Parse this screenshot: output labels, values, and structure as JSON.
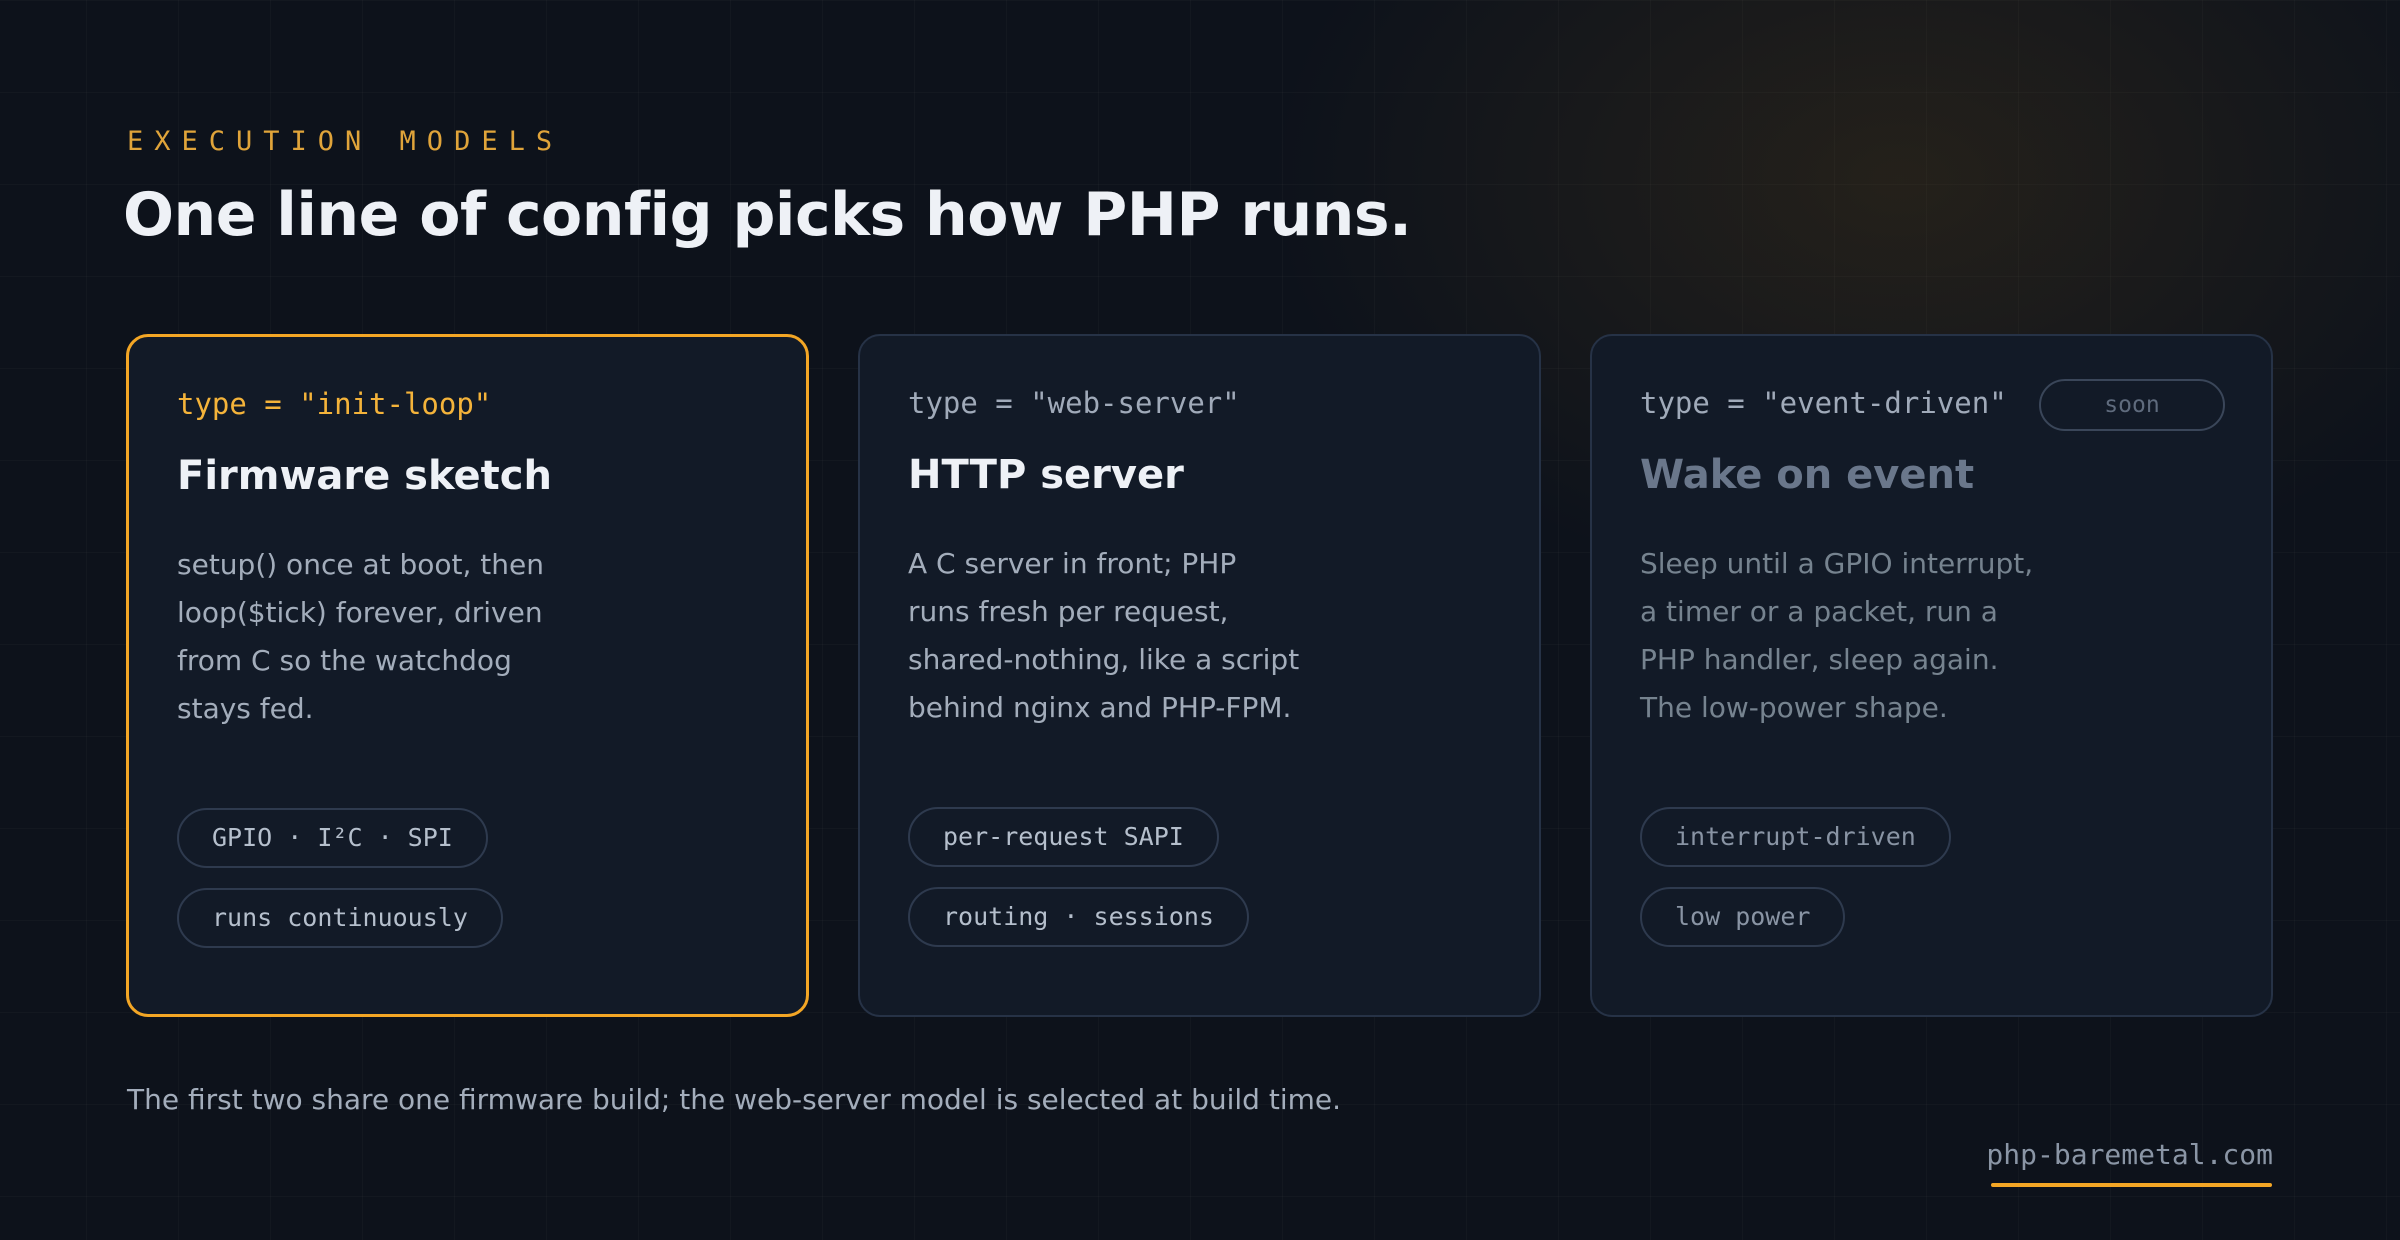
{
  "eyebrow": "EXECUTION MODELS",
  "title": "One line of config picks how PHP runs.",
  "cards": [
    {
      "type_label": "type = \"init-loop\"",
      "title": "Firmware sketch",
      "description": "setup() once at boot, then\nloop($tick) forever, driven\nfrom C so the watchdog\nstays fed.",
      "tags": [
        "GPIO · I²C · SPI",
        "runs continuously"
      ]
    },
    {
      "type_label": "type = \"web-server\"",
      "title": "HTTP server",
      "description": "A C server in front; PHP\nruns fresh per request,\nshared-nothing, like a script\nbehind nginx and PHP-FPM.",
      "tags": [
        "per-request SAPI",
        "routing · sessions"
      ]
    },
    {
      "type_label": "type = \"event-driven\"",
      "badge": "soon",
      "title": "Wake on event",
      "description": "Sleep until a GPIO interrupt,\na timer or a packet, run a\nPHP handler, sleep again.\nThe low-power shape.",
      "tags": [
        "interrupt-driven",
        "low power"
      ]
    }
  ],
  "footnote": "The first two share one firmware build; the web-server model is selected at build time.",
  "site": "php-baremetal.com",
  "colors": {
    "accent": "#f3a625",
    "background": "#0d121b",
    "card": "#121a27"
  }
}
